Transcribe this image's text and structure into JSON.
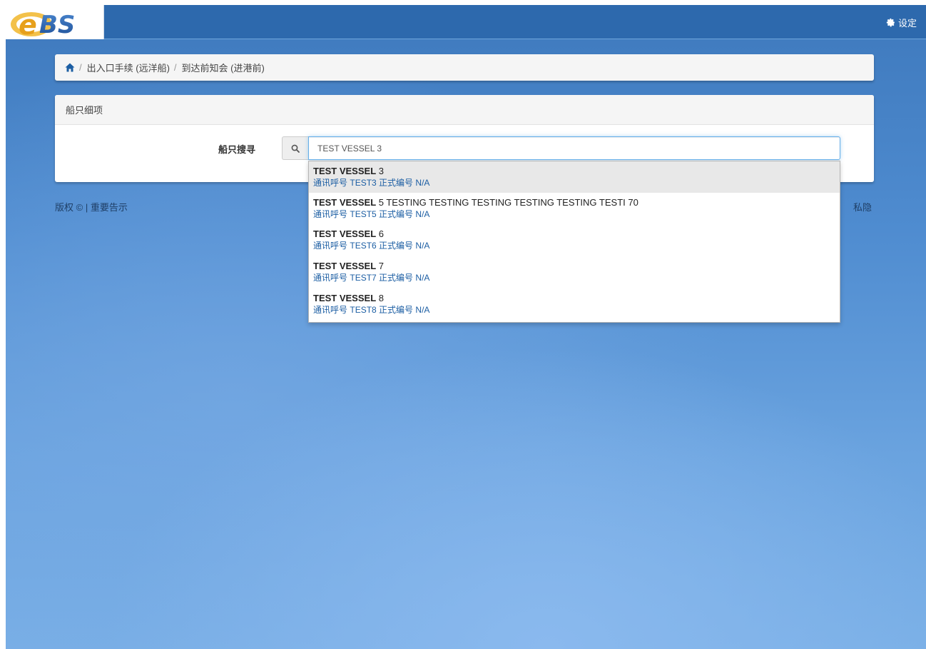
{
  "header": {
    "logo_text": "eBS",
    "settings_label": "设定",
    "settings_icon": "gear-icon"
  },
  "breadcrumb": {
    "home_icon": "home-icon",
    "separator": "/",
    "items": [
      {
        "label": "出入口手续 (远洋船)"
      },
      {
        "label": "到达前知会 (进港前)"
      }
    ]
  },
  "panel": {
    "title": "船只细项",
    "search_label": "船只搜寻",
    "search_icon": "search-icon",
    "search_value": "TEST VESSEL 3"
  },
  "suggestions": [
    {
      "bold": "TEST VESSEL",
      "rest": " 3",
      "callsign_label": "通讯呼号",
      "callsign": "TEST3",
      "reg_label": "正式编号",
      "reg": "N/A"
    },
    {
      "bold": "TEST VESSEL",
      "rest": " 5 TESTING TESTING TESTING TESTING TESTING TESTI 70",
      "callsign_label": "通讯呼号",
      "callsign": "TEST5",
      "reg_label": "正式编号",
      "reg": "N/A"
    },
    {
      "bold": "TEST VESSEL",
      "rest": " 6",
      "callsign_label": "通讯呼号",
      "callsign": "TEST6",
      "reg_label": "正式编号",
      "reg": "N/A"
    },
    {
      "bold": "TEST VESSEL",
      "rest": " 7",
      "callsign_label": "通讯呼号",
      "callsign": "TEST7",
      "reg_label": "正式编号",
      "reg": "N/A"
    },
    {
      "bold": "TEST VESSEL",
      "rest": " 8",
      "callsign_label": "通讯呼号",
      "callsign": "TEST8",
      "reg_label": "正式编号",
      "reg": "N/A"
    }
  ],
  "footer": {
    "copyright": "版权",
    "copyright_symbol": "©",
    "separator": "|",
    "notice": "重要告示",
    "privacy": "私隐"
  },
  "colors": {
    "header_bg": "#2d69ad",
    "link": "#1c5ea3"
  }
}
